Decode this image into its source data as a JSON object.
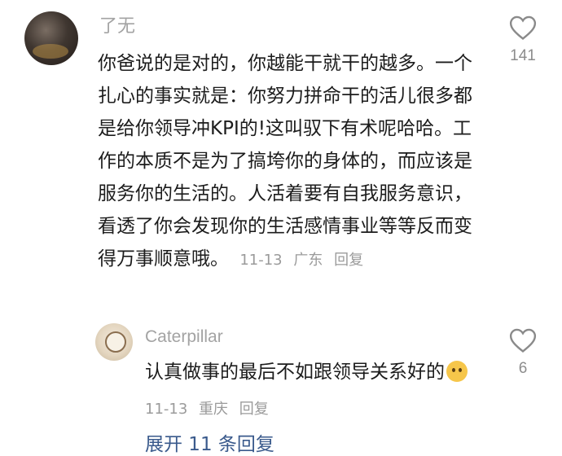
{
  "comment": {
    "username": "了无",
    "text": "你爸说的是对的，你越能干就干的越多。一个扎心的事实就是：你努力拼命干的活儿很多都是给你领导冲KPI的!这叫驭下有术呢哈哈。工作的本质不是为了搞垮你的身体的，而应该是服务你的生活的。人活着要有自我服务意识，看透了你会发现你的生活感情事业等等反而变得万事顺意哦。",
    "date": "11-13",
    "location": "广东",
    "reply_label": "回复",
    "likes": "141"
  },
  "reply": {
    "username": "Caterpillar",
    "text": "认真做事的最后不如跟领导关系好的",
    "emoji": "happy-face-emoji",
    "date": "11-13",
    "location": "重庆",
    "reply_label": "回复",
    "likes": "6"
  },
  "expand_label": "展开 11 条回复",
  "colors": {
    "text": "#1c1c1c",
    "muted": "#9b9b9b",
    "link": "#3a5a8c"
  }
}
